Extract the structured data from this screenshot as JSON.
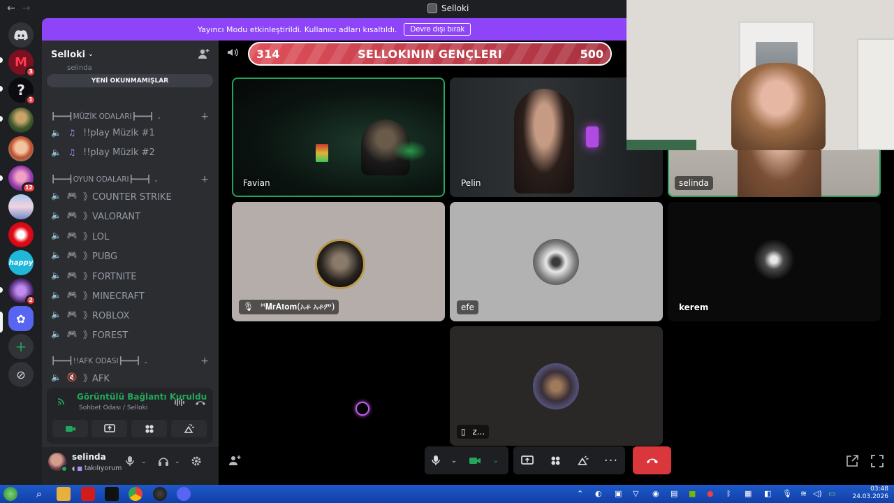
{
  "window": {
    "title": "Selloki"
  },
  "nav": {
    "back": "←",
    "forward": "→"
  },
  "servers": [
    {
      "name": "discord-home",
      "glyph": "",
      "badge": ""
    },
    {
      "name": "server-m",
      "glyph": "M",
      "badge": "3"
    },
    {
      "name": "server-question",
      "glyph": "?",
      "badge": "1"
    },
    {
      "name": "server-soldier",
      "glyph": "",
      "badge": ""
    },
    {
      "name": "server-redhead",
      "glyph": "",
      "badge": ""
    },
    {
      "name": "server-anime",
      "glyph": "",
      "badge": "12"
    },
    {
      "name": "server-landscape",
      "glyph": "",
      "badge": ""
    },
    {
      "name": "server-flag",
      "glyph": "",
      "badge": ""
    },
    {
      "name": "server-happy",
      "glyph": "happy",
      "badge": ""
    },
    {
      "name": "server-streak",
      "glyph": "",
      "badge": "2"
    },
    {
      "name": "server-selloki",
      "glyph": "",
      "badge": ""
    }
  ],
  "streamer_mode": {
    "message": "Yayıncı Modu etkinleştirildi. Kullanıcı adları kısaltıldı.",
    "button": "Devre dışı bırak"
  },
  "guild": {
    "name": "Selloki",
    "chevron": "⌄"
  },
  "sidebar": {
    "unread_pill": "YENİ OKUNMAMIŞLAR",
    "hidden_top": "selinda",
    "categories": [
      {
        "label": "┣━━━┫MÜZİK ODALARI┣━━━┫",
        "channels": [
          {
            "emoji": "♫",
            "name": "!!play Müzik #1"
          },
          {
            "emoji": "♫",
            "name": "!!play Müzik #2"
          }
        ]
      },
      {
        "label": "┣━━━┫OYUN ODALARI┣━━━┫",
        "channels": [
          {
            "emoji": "🎮",
            "name": "》COUNTER STRIKE"
          },
          {
            "emoji": "🎮",
            "name": "》VALORANT"
          },
          {
            "emoji": "🎮",
            "name": "》LOL"
          },
          {
            "emoji": "🎮",
            "name": "》PUBG"
          },
          {
            "emoji": "🎮",
            "name": "》FORTNITE"
          },
          {
            "emoji": "🎮",
            "name": "》MINECRAFT"
          },
          {
            "emoji": "🎮",
            "name": "》ROBLOX"
          },
          {
            "emoji": "🎮",
            "name": "》FOREST"
          }
        ]
      },
      {
        "label": "┣━━━┫!!AFK ODASI┣━━━┫",
        "channels": [
          {
            "emoji": "🔇",
            "name": "》AFK"
          }
        ]
      }
    ]
  },
  "voice": {
    "status": "Görüntülü Bağlantı Kuruldu",
    "location": "Sohbet Odası / Selloki"
  },
  "user": {
    "name": "selinda",
    "status": "takılıyorum"
  },
  "stage": {
    "left_number": "314",
    "title": "SELLOKININ GENÇLERI",
    "right_number": "500"
  },
  "tiles": {
    "favian": "Favian",
    "pelin": "Pelin",
    "selinda": "selinda",
    "mratom": "ᴹ𝐌𝐫𝐀𝐭𝐨𝐦(አቶ አቶም)",
    "efe": "efe",
    "kerem": "kerem",
    "z": "z..."
  },
  "taskbar": {
    "time": "03:48",
    "date": "24.03.2026"
  },
  "colors": {
    "accent": "#8d45f7",
    "speaking": "#23a55a",
    "hangup": "#da373c",
    "stage": "#c23f4c"
  }
}
